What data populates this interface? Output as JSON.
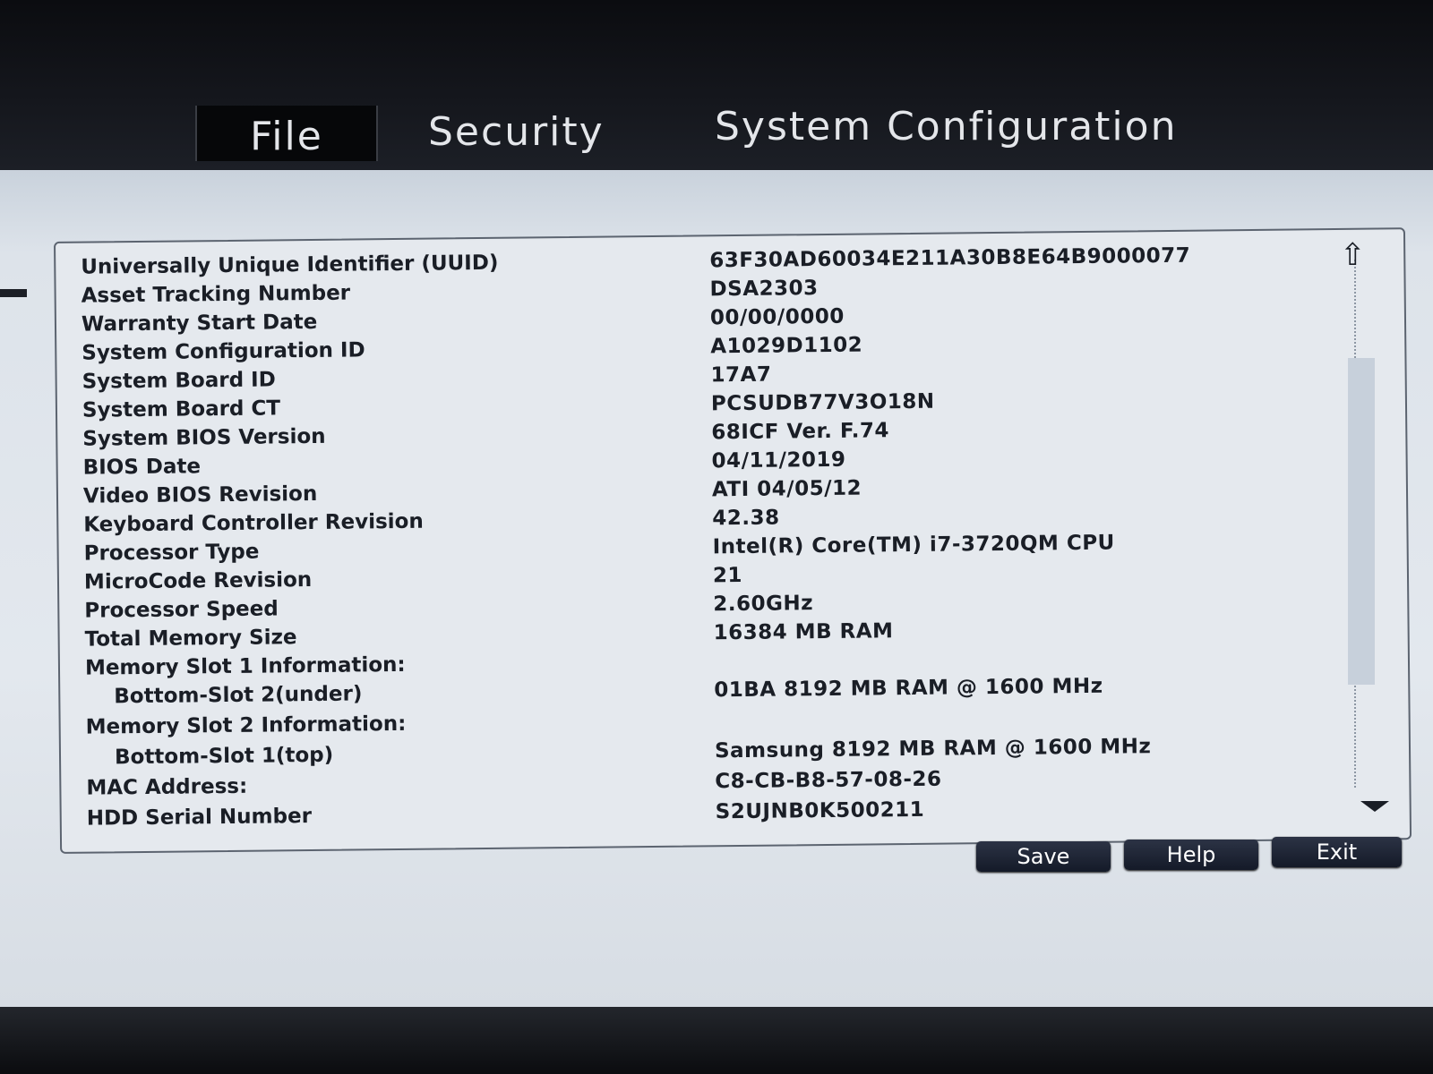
{
  "tabs": {
    "file": "File",
    "security": "Security",
    "system_configuration": "System Configuration"
  },
  "info_rows": [
    {
      "label": "Universally Unique Identifier (UUID)",
      "value": "63F30AD60034E211A30B8E64B9000077"
    },
    {
      "label": "Asset Tracking Number",
      "value": "DSA2303"
    },
    {
      "label": "Warranty Start Date",
      "value": "00/00/0000"
    },
    {
      "label": "System Configuration ID",
      "value": "A1029D1102"
    },
    {
      "label": "System Board ID",
      "value": "17A7"
    },
    {
      "label": "System Board CT",
      "value": "PCSUDB77V3O18N"
    },
    {
      "label": "System BIOS Version",
      "value": "68ICF Ver. F.74"
    },
    {
      "label": "BIOS Date",
      "value": "04/11/2019"
    },
    {
      "label": "Video BIOS Revision",
      "value": "ATI 04/05/12"
    },
    {
      "label": "Keyboard Controller Revision",
      "value": "42.38"
    },
    {
      "label": "Processor Type",
      "value": "Intel(R) Core(TM) i7-3720QM CPU"
    },
    {
      "label": "MicroCode Revision",
      "value": "21"
    },
    {
      "label": "Processor Speed",
      "value": "2.60GHz"
    },
    {
      "label": "Total Memory Size",
      "value": "16384 MB RAM"
    },
    {
      "label": "Memory Slot 1 Information:",
      "value": ""
    },
    {
      "label": "Bottom-Slot 2(under)",
      "value": "01BA 8192 MB RAM @ 1600 MHz"
    },
    {
      "label": "Memory Slot 2 Information:",
      "value": ""
    },
    {
      "label": "Bottom-Slot 1(top)",
      "value": "Samsung 8192 MB RAM @ 1600 MHz"
    },
    {
      "label": "MAC Address:",
      "value": "C8-CB-B8-57-08-26"
    },
    {
      "label": "HDD Serial Number",
      "value": "S2UJNB0K500211"
    }
  ],
  "scroll": {
    "up_icon": "scroll-up-arrow",
    "down_icon": "scroll-down-arrow",
    "thumb_position_fraction": 0.2
  },
  "buttons": {
    "save": "Save",
    "help": "Help",
    "exit": "Exit"
  }
}
